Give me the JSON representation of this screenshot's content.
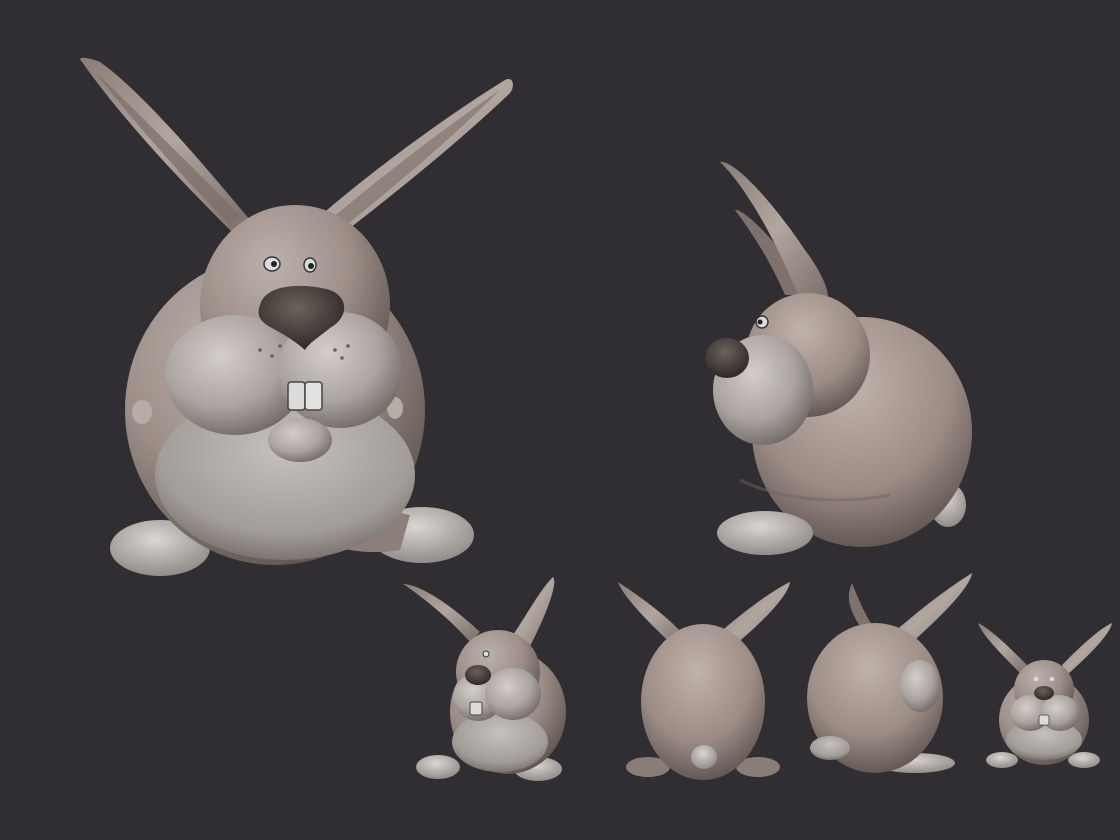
{
  "scene": {
    "background": "#302e33",
    "clay_color": "#9d8f88",
    "clay_light": "#c9c0bb",
    "clay_dark": "#6f625c",
    "belly_color": "#b9b4b1",
    "nose_color": "#3f3834",
    "teeth_color": "#dedcda"
  },
  "views": [
    {
      "name": "hero-front",
      "icon": "bunny-sculpt-front-three-quarter"
    },
    {
      "name": "hero-side",
      "icon": "bunny-sculpt-side"
    },
    {
      "name": "thumb-front",
      "icon": "bunny-sculpt-front-thumbnail"
    },
    {
      "name": "thumb-back",
      "icon": "bunny-sculpt-back-thumbnail"
    },
    {
      "name": "thumb-side",
      "icon": "bunny-sculpt-side-thumbnail"
    },
    {
      "name": "thumb-small",
      "icon": "bunny-sculpt-small-front-thumbnail"
    }
  ]
}
